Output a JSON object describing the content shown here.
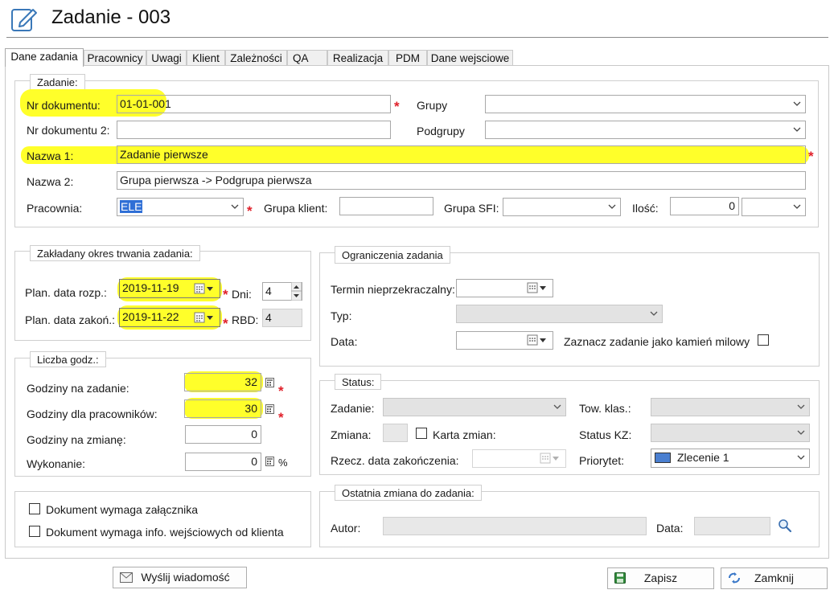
{
  "window": {
    "title": "Zadanie - 003",
    "icon": "edit-note-icon"
  },
  "tabs": [
    "Dane zadania",
    "Pracownicy",
    "Uwagi",
    "Klient",
    "Zależności",
    "QA",
    "Realizacja",
    "PDM",
    "Dane wejsciowe"
  ],
  "zadanie": {
    "legend": "Zadanie:",
    "nr_dokumentu_label": "Nr dokumentu:",
    "nr_dokumentu_value": "01-01-001",
    "nr_dokumentu2_label": "Nr dokumentu 2:",
    "nr_dokumentu2_value": "",
    "grupy_label": "Grupy",
    "grupy_value": "",
    "podgrupy_label": "Podgrupy",
    "podgrupy_value": "",
    "nazwa1_label": "Nazwa 1:",
    "nazwa1_value": "Zadanie pierwsze",
    "nazwa2_label": "Nazwa 2:",
    "nazwa2_value": "Grupa pierwsza -> Podgrupa pierwsza",
    "pracownia_label": "Pracownia:",
    "pracownia_value": "ELE",
    "grupa_klient_label": "Grupa klient:",
    "grupa_klient_value": "",
    "grupa_sfi_label": "Grupa SFI:",
    "grupa_sfi_value": "",
    "ilosc_label": "Ilość:",
    "ilosc_value": "0",
    "ilosc_unit_value": ""
  },
  "okres": {
    "legend": "Zakładany okres trwania zadania:",
    "plan_rozp_label": "Plan. data rozp.:",
    "plan_rozp_value": "2019-11-19",
    "dni_label": "Dni:",
    "dni_value": "4",
    "plan_zakon_label": "Plan. data zakoń.:",
    "plan_zakon_value": "2019-11-22",
    "rbd_label": "RBD:",
    "rbd_value": "4"
  },
  "ograniczenia": {
    "legend": "Ograniczenia zadania",
    "termin_label": "Termin nieprzekraczalny:",
    "termin_value": "",
    "typ_label": "Typ:",
    "typ_value": "",
    "data_label": "Data:",
    "data_value": "",
    "kamien_label": "Zaznacz zadanie jako kamień milowy"
  },
  "liczba": {
    "legend": "Liczba godz.:",
    "godz_zadanie_label": "Godziny na zadanie:",
    "godz_zadanie_value": "32",
    "godz_prac_label": "Godziny dla pracowników:",
    "godz_prac_value": "30",
    "godz_zmiane_label": "Godziny na zmianę:",
    "godz_zmiane_value": "0",
    "wykonanie_label": "Wykonanie:",
    "wykonanie_value": "0",
    "wykonanie_unit": "%"
  },
  "status": {
    "legend": "Status:",
    "zadanie_label": "Zadanie:",
    "zadanie_value": "",
    "tow_klas_label": "Tow. klas.:",
    "tow_klas_value": "",
    "zmiana_label": "Zmiana:",
    "zmiana_value": "",
    "karta_zmian_label": "Karta zmian:",
    "status_kz_label": "Status KZ:",
    "status_kz_value": "",
    "rzecz_data_label": "Rzecz. data zakończenia:",
    "rzecz_data_value": "",
    "priorytet_label": "Priorytet:",
    "priorytet_value": "Zlecenie 1",
    "priorytet_color": "#4a7fd0"
  },
  "dokument": {
    "zalacznik_label": "Dokument wymaga załącznika",
    "info_label": "Dokument wymaga info. wejściowych od klienta"
  },
  "ostatnia": {
    "legend": "Ostatnia zmiana do zadania:",
    "autor_label": "Autor:",
    "autor_value": "",
    "data_label": "Data:",
    "data_value": ""
  },
  "buttons": {
    "wyslij": "Wyślij wiadomość",
    "zapisz": "Zapisz",
    "zamknij": "Zamknij"
  },
  "colors": {
    "highlight": "#ffff2a",
    "required": "#e0202a",
    "selection": "#2f6fd6"
  }
}
